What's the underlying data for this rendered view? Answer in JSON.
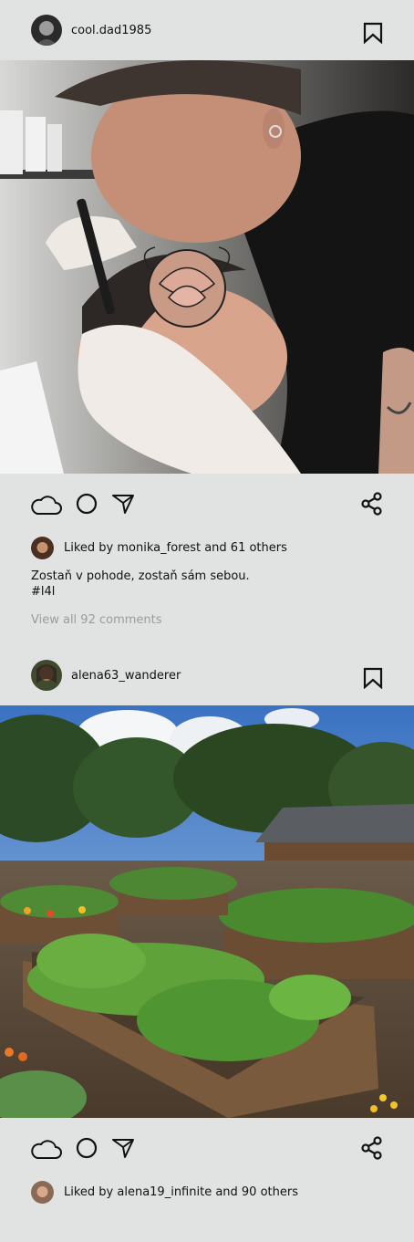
{
  "posts": [
    {
      "username": "cool.dad1985",
      "likes": {
        "liked_by": "Liked by monika_forest and 61 others"
      },
      "caption": {
        "line1": "Zostaň v pohode, zostaň sám sebou.",
        "line2": "#l4l"
      },
      "view_comments": "View all 92 comments",
      "icons": [
        "avatar",
        "bookmark-icon",
        "cloud-icon",
        "circle-icon",
        "send-icon",
        "share-icon"
      ]
    },
    {
      "username": "alena63_wanderer",
      "likes": {
        "liked_by": "Liked by alena19_infinite and 90 others"
      },
      "icons": [
        "avatar",
        "bookmark-icon",
        "cloud-icon",
        "circle-icon",
        "send-icon",
        "share-icon"
      ]
    }
  ],
  "colors": {
    "background": "#e1e3e3",
    "text": "#111111",
    "muted": "#9a9c9c"
  }
}
